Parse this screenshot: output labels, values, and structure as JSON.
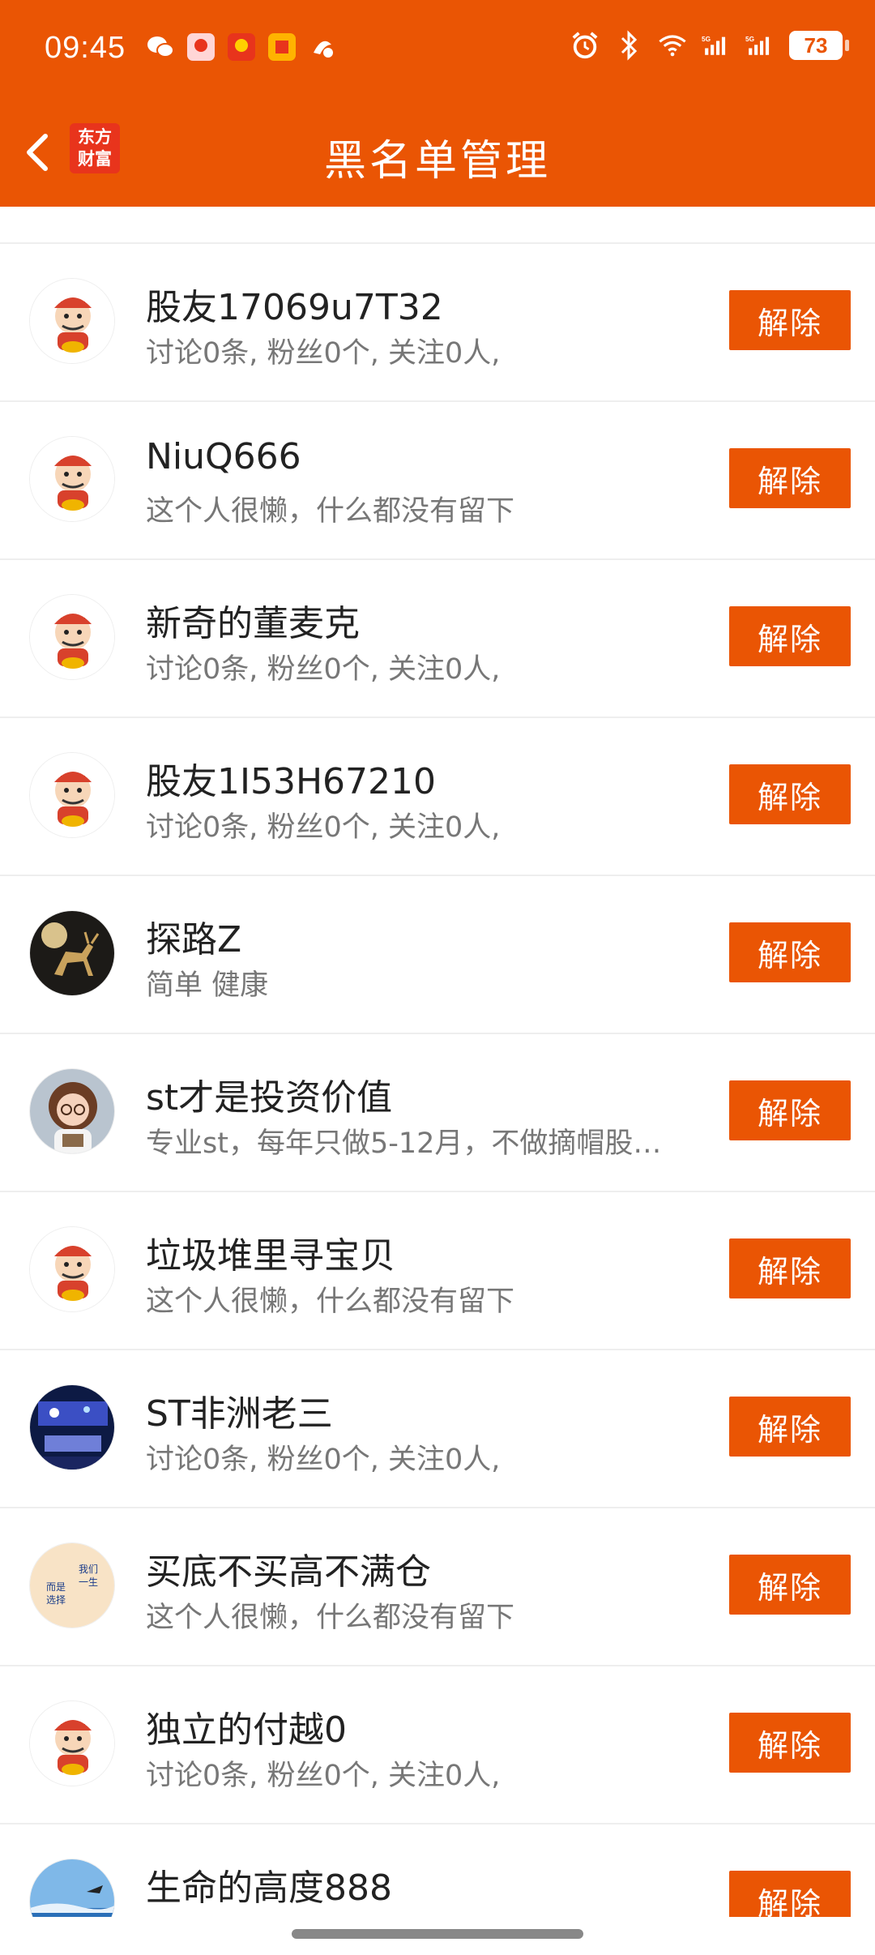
{
  "status_bar": {
    "time": "09:45",
    "left_icons": [
      "wechat-icon",
      "app-icon-1",
      "app-icon-2",
      "app-icon-3",
      "app-icon-4"
    ],
    "battery": "73"
  },
  "header": {
    "title": "黑名单管理",
    "logo_line1": "东方",
    "logo_line2": "财富",
    "accent_color": "#ea5504"
  },
  "list": {
    "unblock_label": "解除",
    "items": [
      {
        "name": "股友17069u7T32",
        "desc": "讨论0条, 粉丝0个, 关注0人,",
        "avatar": "cartoon-avatar"
      },
      {
        "name": "NiuQ666",
        "desc": "这个人很懒，什么都没有留下",
        "avatar": "cartoon-avatar"
      },
      {
        "name": "新奇的董麦克",
        "desc": "讨论0条, 粉丝0个, 关注0人,",
        "avatar": "cartoon-avatar"
      },
      {
        "name": "股友1I53H67210",
        "desc": "讨论0条, 粉丝0个, 关注0人,",
        "avatar": "cartoon-avatar"
      },
      {
        "name": "探路Z",
        "desc": "简单  健康",
        "avatar": "deer-photo"
      },
      {
        "name": "st才是投资价值",
        "desc": "专业st，每年只做5-12月，不做摘帽股…",
        "avatar": "girl-cartoon"
      },
      {
        "name": "垃圾堆里寻宝贝",
        "desc": "这个人很懒，什么都没有留下",
        "avatar": "cartoon-avatar"
      },
      {
        "name": "ST非洲老三",
        "desc": "讨论0条, 粉丝0个, 关注0人,",
        "avatar": "room-photo"
      },
      {
        "name": "买底不买高不满仓",
        "desc": "这个人很懒，什么都没有留下",
        "avatar": "text-avatar"
      },
      {
        "name": "独立的付越0",
        "desc": "讨论0条, 粉丝0个, 关注0人,",
        "avatar": "cartoon-avatar"
      },
      {
        "name": "生命的高度888",
        "desc": "",
        "avatar": "sky-photo"
      }
    ]
  }
}
